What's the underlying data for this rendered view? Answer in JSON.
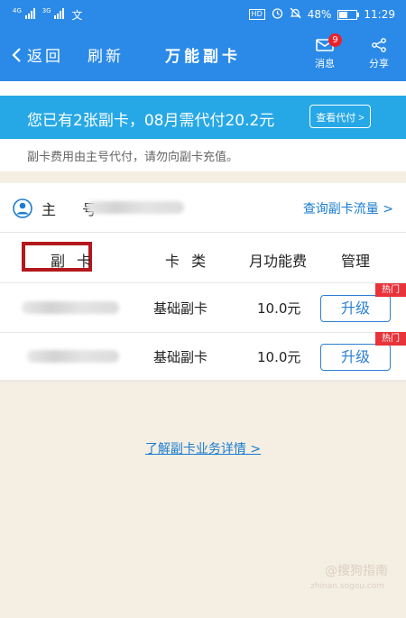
{
  "status_bar": {
    "net1": "4G",
    "net2": "3G",
    "extra_icon": "文",
    "hd": "HD",
    "battery": "48%",
    "battery_level": 0.48,
    "time": "11:29"
  },
  "navbar": {
    "back_label": "返回",
    "refresh_label": "刷新",
    "title": "万能副卡",
    "message_label": "消息",
    "message_count": "9",
    "share_label": "分享"
  },
  "banner": {
    "text": "您已有2张副卡，08月需代付20.2元",
    "button_label": "查看代付 >"
  },
  "notice": {
    "text": "副卡费用由主号代付，请勿向副卡充值。"
  },
  "main_number": {
    "label": "主 号",
    "query_link": "查询副卡流量 >"
  },
  "table": {
    "headers": {
      "card": "副 卡",
      "type": "卡 类",
      "fee": "月功能费",
      "manage": "管理"
    },
    "rows": [
      {
        "type": "基础副卡",
        "fee": "10.0元",
        "action": "升级",
        "tag": "热门"
      },
      {
        "type": "基础副卡",
        "fee": "10.0元",
        "action": "升级",
        "tag": "热门"
      }
    ]
  },
  "detail_link": "了解副卡业务详情 >",
  "watermark": {
    "brand": "@搜狗指南",
    "url": "zhinan.sogou.com"
  },
  "colors": {
    "header_blue": "#2b8ae8",
    "banner_blue": "#27a8e6",
    "link_blue": "#1a7ccf",
    "hot_red": "#e8333a",
    "highlight_red": "#b3181c",
    "page_bg": "#f5eee3"
  }
}
